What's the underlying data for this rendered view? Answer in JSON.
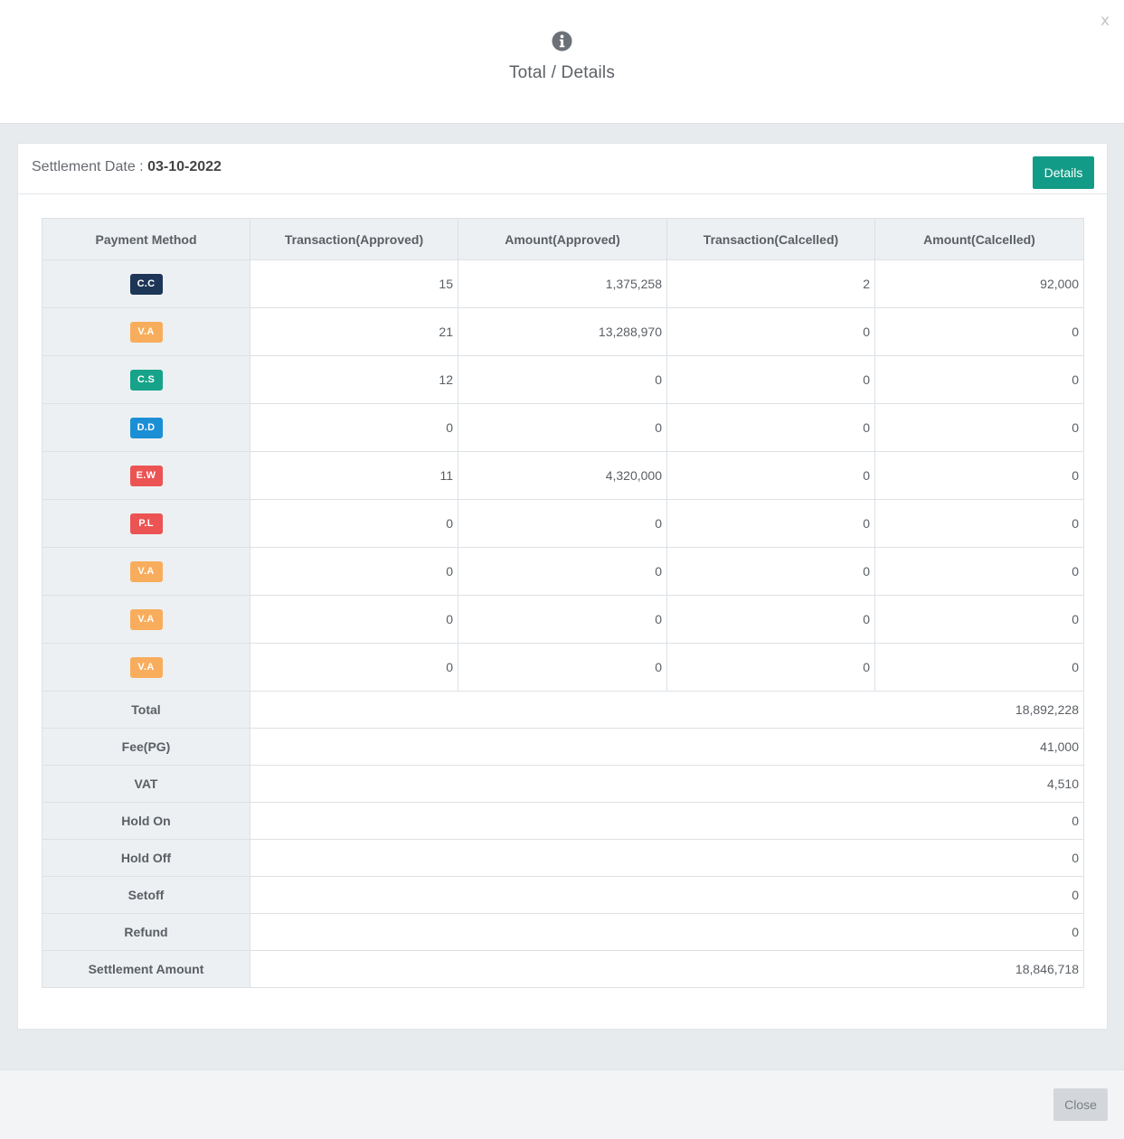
{
  "header": {
    "icon": "info-icon",
    "title": "Total / Details",
    "close_symbol": "x"
  },
  "card": {
    "settlement_label": "Settlement Date : ",
    "settlement_date": "03-10-2022",
    "details_button": "Details"
  },
  "table": {
    "columns": [
      "Payment Method",
      "Transaction(Approved)",
      "Amount(Approved)",
      "Transaction(Calcelled)",
      "Amount(Calcelled)"
    ],
    "rows": [
      {
        "method": "C.C",
        "color": "#1d3557",
        "tx_approved": "15",
        "amt_approved": "1,375,258",
        "tx_cancelled": "2",
        "amt_cancelled": "92,000"
      },
      {
        "method": "V.A",
        "color": "#f8ad5c",
        "tx_approved": "21",
        "amt_approved": "13,288,970",
        "tx_cancelled": "0",
        "amt_cancelled": "0"
      },
      {
        "method": "C.S",
        "color": "#16a389",
        "tx_approved": "12",
        "amt_approved": "0",
        "tx_cancelled": "0",
        "amt_cancelled": "0"
      },
      {
        "method": "D.D",
        "color": "#1a8fd6",
        "tx_approved": "0",
        "amt_approved": "0",
        "tx_cancelled": "0",
        "amt_cancelled": "0"
      },
      {
        "method": "E.W",
        "color": "#ec5353",
        "tx_approved": "11",
        "amt_approved": "4,320,000",
        "tx_cancelled": "0",
        "amt_cancelled": "0"
      },
      {
        "method": "P.L",
        "color": "#ec5353",
        "tx_approved": "0",
        "amt_approved": "0",
        "tx_cancelled": "0",
        "amt_cancelled": "0"
      },
      {
        "method": "V.A",
        "color": "#f8ad5c",
        "tx_approved": "0",
        "amt_approved": "0",
        "tx_cancelled": "0",
        "amt_cancelled": "0"
      },
      {
        "method": "V.A",
        "color": "#f8ad5c",
        "tx_approved": "0",
        "amt_approved": "0",
        "tx_cancelled": "0",
        "amt_cancelled": "0"
      },
      {
        "method": "V.A",
        "color": "#f8ad5c",
        "tx_approved": "0",
        "amt_approved": "0",
        "tx_cancelled": "0",
        "amt_cancelled": "0"
      }
    ],
    "summary": [
      {
        "label": "Total",
        "value": "18,892,228"
      },
      {
        "label": "Fee(PG)",
        "value": "41,000"
      },
      {
        "label": "VAT",
        "value": "4,510"
      },
      {
        "label": "Hold On",
        "value": "0"
      },
      {
        "label": "Hold Off",
        "value": "0"
      },
      {
        "label": "Setoff",
        "value": "0"
      },
      {
        "label": "Refund",
        "value": "0"
      },
      {
        "label": "Settlement Amount",
        "value": "18,846,718"
      }
    ]
  },
  "footer": {
    "close_button": "Close"
  },
  "colors": {
    "accent": "#129b86",
    "header_bg": "#edf0f2"
  }
}
